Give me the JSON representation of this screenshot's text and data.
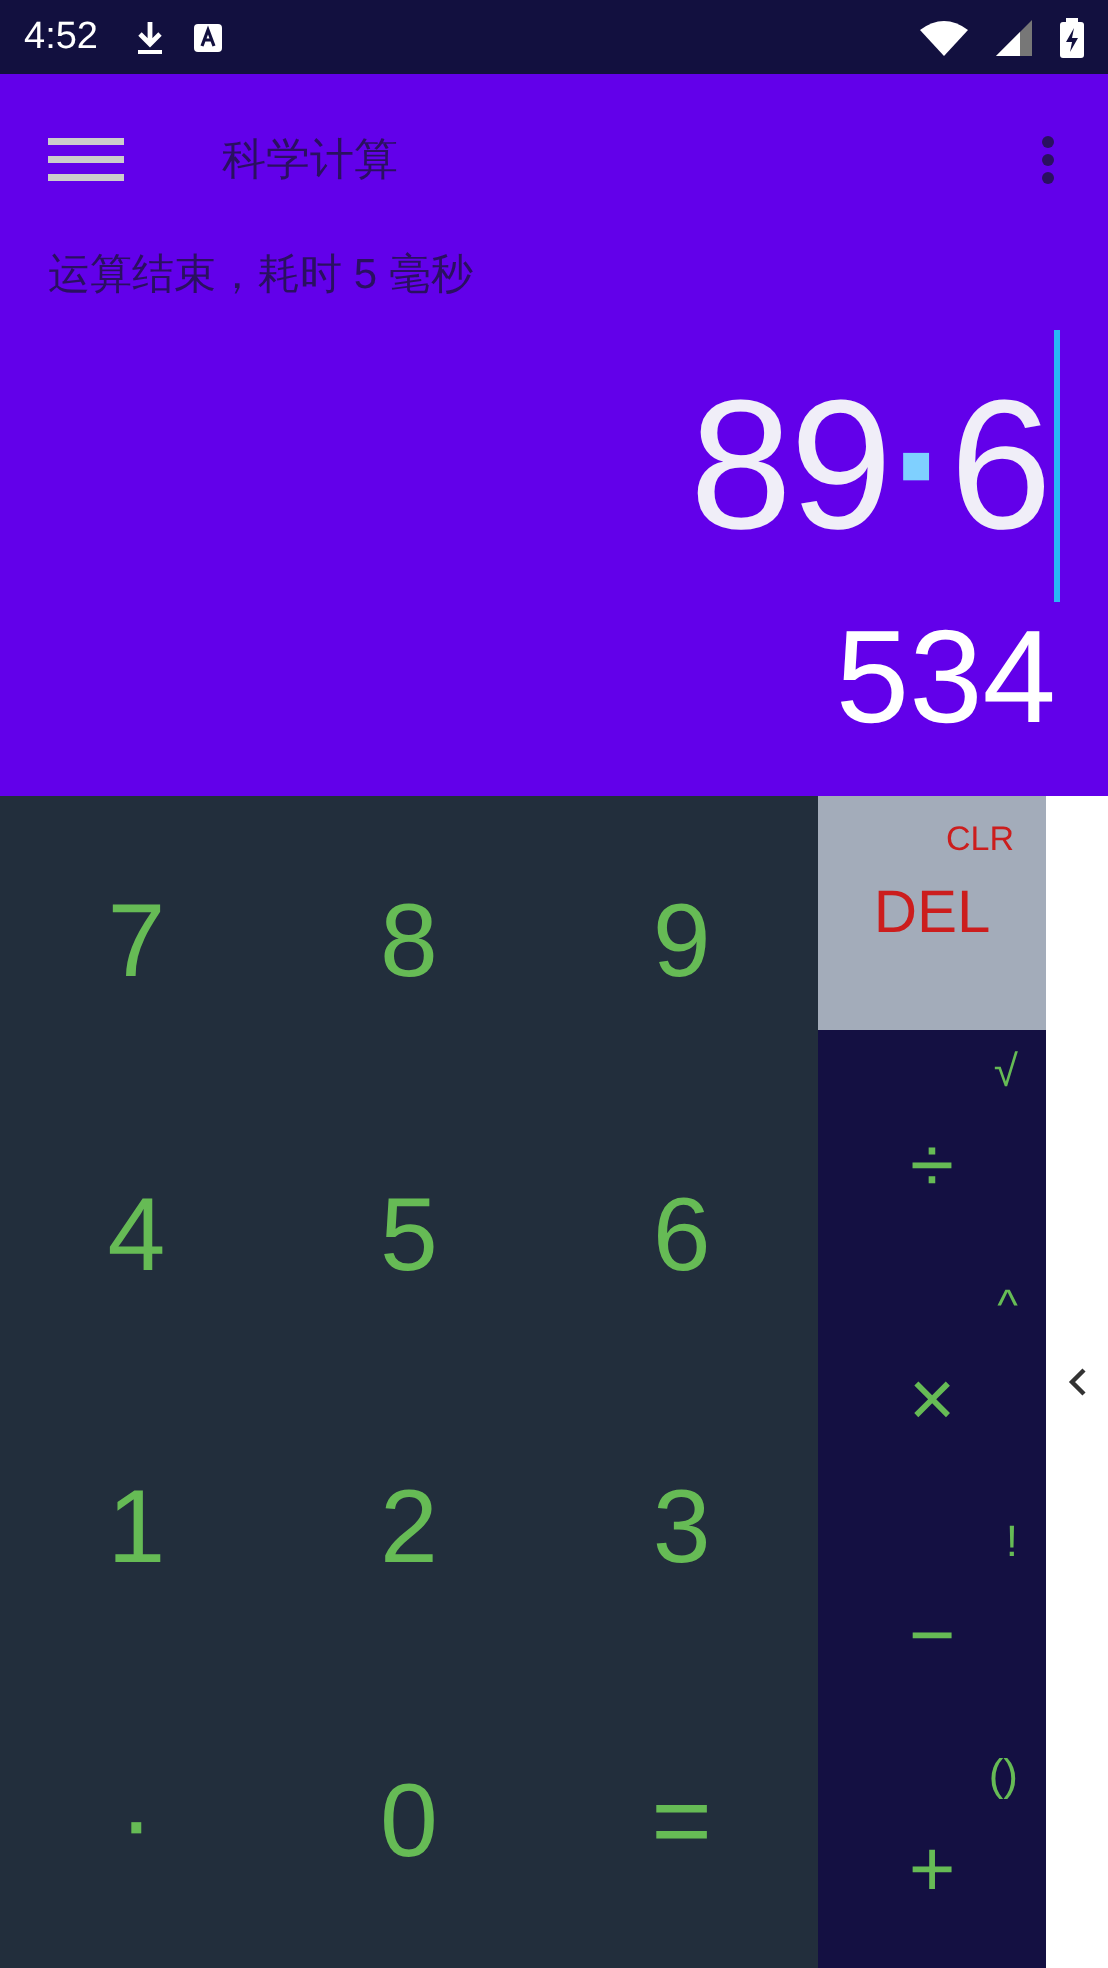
{
  "status_bar": {
    "time": "4:52"
  },
  "toolbar": {
    "title": "科学计算"
  },
  "message": "运算结束，耗时 5 毫秒",
  "display": {
    "expression": [
      {
        "kind": "digits",
        "text": "89"
      },
      {
        "kind": "point",
        "text": "·"
      },
      {
        "kind": "digits",
        "text": "6"
      }
    ],
    "result": "534"
  },
  "keypad": {
    "digits": [
      "7",
      "8",
      "9",
      "4",
      "5",
      "6",
      "1",
      "2",
      "3",
      "·",
      "0",
      "="
    ],
    "delete": {
      "label": "DEL",
      "alt": "CLR"
    },
    "operators": [
      {
        "label": "÷",
        "alt": "√"
      },
      {
        "label": "×",
        "alt": "^"
      },
      {
        "label": "−",
        "alt": "!"
      },
      {
        "label": "+",
        "alt": "()"
      }
    ]
  },
  "side_panel": {
    "expanded": false
  }
}
